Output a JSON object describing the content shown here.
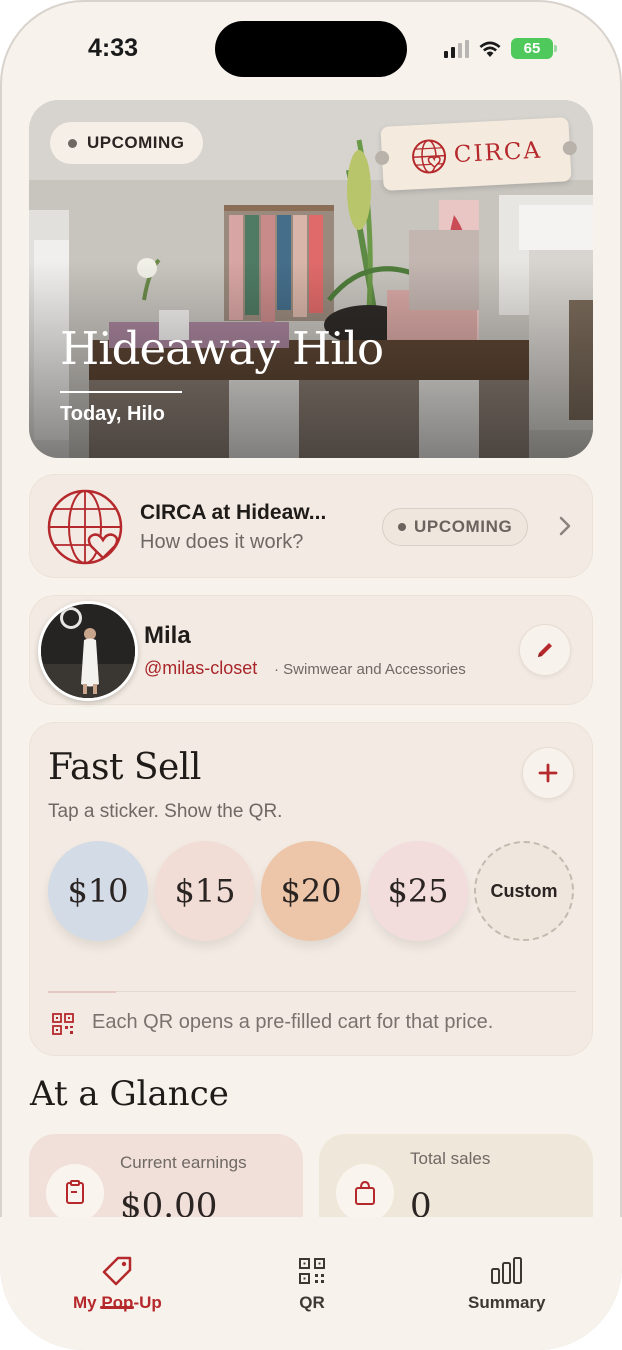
{
  "status_bar": {
    "time": "4:33",
    "battery": "65"
  },
  "hero": {
    "badge": "UPCOMING",
    "brand": "CIRCA",
    "title": "Hideaway Hilo",
    "subtitle": "Today, Hilo"
  },
  "event": {
    "title": "CIRCA at Hideaw...",
    "subtitle": "How does it work?",
    "status": "UPCOMING"
  },
  "seller": {
    "name": "Mila",
    "handle": "@milas-closet",
    "category": "· Swimwear and Accessories"
  },
  "fast_sell": {
    "title": "Fast Sell",
    "subtitle": "Tap a sticker. Show the QR.",
    "stickers": [
      {
        "label": "$10",
        "color": "#d3dbe6"
      },
      {
        "label": "$15",
        "color": "#f1dcd6"
      },
      {
        "label": "$20",
        "color": "#edc5a8"
      },
      {
        "label": "$25",
        "color": "#f2dcdc"
      }
    ],
    "custom_label": "Custom",
    "note": "Each QR opens a pre-filled cart for that price."
  },
  "glance": {
    "title": "At a Glance",
    "earnings_label": "Current earnings",
    "earnings_value": "$0.00",
    "sales_label": "Total sales",
    "sales_value": "0"
  },
  "tabs": [
    {
      "label": "My Pop-Up",
      "icon": "tag-icon",
      "active": true
    },
    {
      "label": "QR",
      "icon": "qr-icon",
      "active": false
    },
    {
      "label": "Summary",
      "icon": "bar-chart-icon",
      "active": false
    }
  ],
  "colors": {
    "accent": "#b5282c",
    "background": "#f7f2ec",
    "card": "#f3ebe3"
  }
}
